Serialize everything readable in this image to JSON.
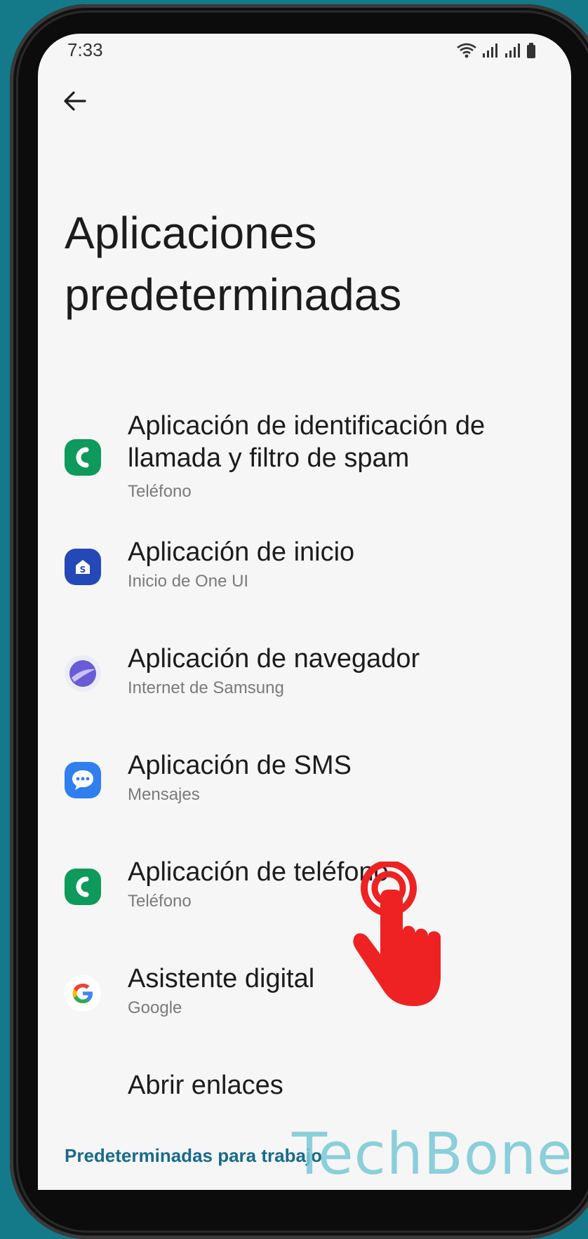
{
  "status_bar": {
    "time": "7:33"
  },
  "page": {
    "title": "Aplicaciones predeterminadas"
  },
  "items": [
    {
      "title": "Aplicación de identificación de llamada y filtro de spam",
      "subtitle": "Teléfono",
      "icon": "phone-app-icon",
      "color": "#0d9a5c"
    },
    {
      "title": "Aplicación de inicio",
      "subtitle": "Inicio de One UI",
      "icon": "home-app-icon",
      "color": "#2548b8"
    },
    {
      "title": "Aplicación de navegador",
      "subtitle": "Internet de Samsung",
      "icon": "browser-app-icon",
      "color": "#6a5bd6"
    },
    {
      "title": "Aplicación de SMS",
      "subtitle": "Mensajes",
      "icon": "messages-app-icon",
      "color": "#2f7ff0"
    },
    {
      "title": "Aplicación de teléfono",
      "subtitle": "Teléfono",
      "icon": "phone-app-icon",
      "color": "#0d9a5c"
    },
    {
      "title": "Asistente digital",
      "subtitle": "Google",
      "icon": "google-icon"
    },
    {
      "title": "Abrir enlaces"
    }
  ],
  "footer": {
    "work_link": "Predeterminadas para trabajo"
  },
  "watermark": {
    "text": "TechBone"
  },
  "overlay": {
    "icon": "tap-hand-icon",
    "color": "#ee2222"
  }
}
